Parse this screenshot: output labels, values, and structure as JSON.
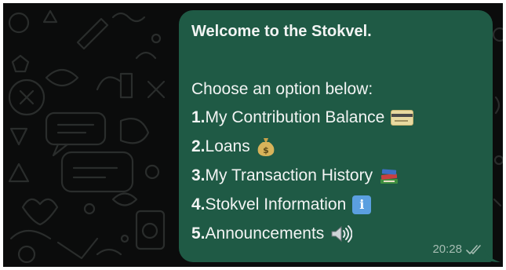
{
  "chat": {
    "message": {
      "title": "Welcome to the Stokvel.",
      "subtitle": "Choose an option below:",
      "options": [
        {
          "num": "1.",
          "label": " My Contribution Balance",
          "icon": "credit-card-icon"
        },
        {
          "num": "2.",
          "label": " Loans",
          "icon": "money-bag-icon"
        },
        {
          "num": "3.",
          "label": " My Transaction History",
          "icon": "books-icon"
        },
        {
          "num": "4.",
          "label": " Stokvel Information",
          "icon": "information-icon"
        },
        {
          "num": "5.",
          "label": " Announcements",
          "icon": "speaker-icon"
        }
      ],
      "info_glyph": "i",
      "time": "20:28",
      "status": "read-ticks-icon"
    }
  },
  "colors": {
    "background": "#0b0c0c",
    "doodle": "#2a2d2c",
    "bubble": "#1f5a45",
    "text": "#f2f4f3",
    "meta_text": "#a6bdb3"
  }
}
